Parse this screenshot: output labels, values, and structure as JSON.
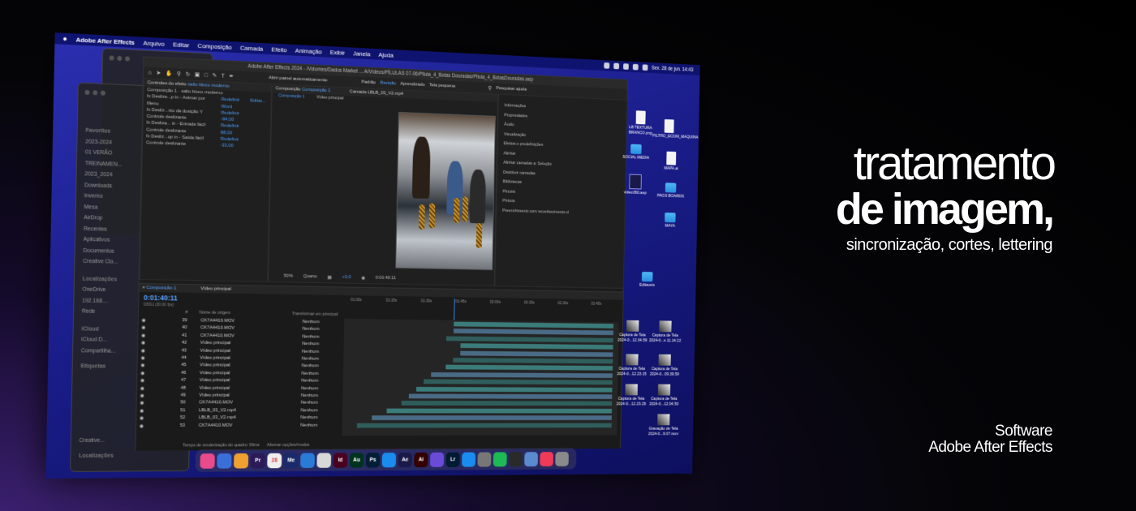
{
  "menubar": {
    "apple": "",
    "app": "Adobe After Effects",
    "items": [
      "Arquivo",
      "Editar",
      "Composição",
      "Camada",
      "Efeito",
      "Animação",
      "Exibir",
      "Janela",
      "Ajuda"
    ],
    "clock": "Sex. 28 de jun.  14:43"
  },
  "finder": {
    "favorites_header": "Favoritos",
    "items": [
      "2023-2024",
      "01 VERÃO",
      "TREINAMEN...",
      "2023_2024",
      "Downloads",
      "Inverno",
      "Mesa",
      "AirDrop",
      "Recentes",
      "Aplicativos",
      "Documentos",
      "Creative Clo..."
    ],
    "locations_header": "Localizações",
    "locations": [
      "OneDrive",
      "192.168....",
      "Rede"
    ],
    "icloud_header": "iCloud",
    "icloud": [
      "iCloud D...",
      "Compartilha..."
    ],
    "tags_header": "Etiquetas",
    "creative": "Creative...",
    "loc2": "Localizações"
  },
  "ae": {
    "title": "Adobe After Effects 2024 - /Volumes/Dados Market ... A/Vídeos/PÍLULAS 07-06/Pilula_4_Botas Douradas/Pilula_4_BotasDouradas.aep",
    "auto_open": "Abrir painel automaticamente",
    "workspace": [
      "Padrão",
      "Revisão",
      "Aprendizado",
      "Tela pequena"
    ],
    "effects_panel": "Controles do efeito",
    "effects_layer": "salto bloco moderno",
    "comp_tab": "Composição",
    "comp_name": "Composição 1",
    "effects_rows": [
      {
        "label": "Composição 1 · salto bloco moderno",
        "v": ""
      },
      {
        "label": "fx  Deslize...p in - Animar por",
        "v": "Redefinir",
        "e": "Editar..."
      },
      {
        "label": "    Menu",
        "v": "Word"
      },
      {
        "label": "fx  Desliz...nto da dosição Y",
        "v": "Redefinir"
      },
      {
        "label": "    Controle deslizante",
        "v": "-94,00"
      },
      {
        "label": "fx  Desliza... in - Entrada fácil",
        "v": "Redefinir"
      },
      {
        "label": "    Controle deslizante",
        "v": "88,00"
      },
      {
        "label": "fx  Desliz...op in - Saída fácil",
        "v": "Redefinir"
      },
      {
        "label": "    Controle deslizante",
        "v": "-33,00"
      }
    ],
    "footage_tab": "Camada LBLB_03_V2.mp4",
    "comp_subtabs": [
      "Composição 1",
      "Vídeo principal"
    ],
    "viewer_zoom": "50%",
    "viewer_res": "Quarto",
    "viewer_exposure": "+0,0",
    "viewer_time": "0:01:40:11",
    "right_panel": {
      "search": "Pesquisar ajuda",
      "items": [
        "Informações",
        "Propriedades",
        "Áudio",
        "Visualização",
        "Efeitos e predefinições",
        "Alinhar",
        "Alinhar camadas a:  Seleção",
        "Distribuir camadas",
        "Bibliotecas",
        "Pincéis",
        "Pintura",
        "Preenchimento com reconhecimento d"
      ]
    },
    "timeline": {
      "tab": "Composição 1",
      "tab2": "Vídeo principal",
      "time": "0:01:40:11",
      "fps": "03011 (30,00 fps)",
      "cols": [
        "#",
        "Nome de origem",
        "Transformar em principal"
      ],
      "ruler": [
        "01:00s",
        "01:15s",
        "01:30s",
        "01:45s",
        "02:00s",
        "02:15s",
        "02:30s",
        "02:45s"
      ],
      "layers": [
        {
          "n": "39",
          "name": "CK7A4410.MOV",
          "p": "Nenhum"
        },
        {
          "n": "40",
          "name": "CK7A4410.MOV",
          "p": "Nenhum"
        },
        {
          "n": "41",
          "name": "CK7A4410.MOV",
          "p": "Nenhum"
        },
        {
          "n": "42",
          "name": "Vídeo principal",
          "p": "Nenhum"
        },
        {
          "n": "43",
          "name": "Vídeo principal",
          "p": "Nenhum"
        },
        {
          "n": "44",
          "name": "Vídeo principal",
          "p": "Nenhum"
        },
        {
          "n": "45",
          "name": "Vídeo principal",
          "p": "Nenhum"
        },
        {
          "n": "46",
          "name": "Vídeo principal",
          "p": "Nenhum"
        },
        {
          "n": "47",
          "name": "Vídeo principal",
          "p": "Nenhum"
        },
        {
          "n": "48",
          "name": "Vídeo principal",
          "p": "Nenhum"
        },
        {
          "n": "49",
          "name": "Vídeo principal",
          "p": "Nenhum"
        },
        {
          "n": "50",
          "name": "CK7A4410.MOV",
          "p": "Nenhum"
        },
        {
          "n": "51",
          "name": "LBLB_03_V2.mp4",
          "p": "Nenhum"
        },
        {
          "n": "52",
          "name": "LBLB_03_V2.mp4",
          "p": "Nenhum"
        },
        {
          "n": "53",
          "name": "CK7A4410.MOV",
          "p": "Nenhum"
        }
      ],
      "render_time": "Tempo de renderização do quadro: 56ms",
      "toggle": "Alternar opções/modos"
    }
  },
  "desktop": {
    "icons": [
      {
        "label": "LB TEXTURA BRANCO.png",
        "kind": "doc"
      },
      {
        "label": "FILTRO_ECOM_MAQUINA.xmp",
        "kind": "doc"
      },
      {
        "label": "SOCIAL MEDIA",
        "kind": "fold"
      },
      {
        "label": "MAPA.ai",
        "kind": "doc"
      },
      {
        "label": "video360.aep",
        "kind": "ae"
      },
      {
        "label": "PAGS BOARDS",
        "kind": "fold"
      },
      {
        "label": "MAYA",
        "kind": "fold"
      },
      {
        "label": "Editaveis",
        "kind": "fold"
      },
      {
        "label": "Captura de Tela 2024-0...12.04.59",
        "kind": "shot"
      },
      {
        "label": "Captura de Tela 2024-0...s 11.14.22",
        "kind": "shot"
      },
      {
        "label": "Captura de Tela 2024-0...12.23.15",
        "kind": "shot"
      },
      {
        "label": "Captura de Tela 2024-0...09.39.59",
        "kind": "shot"
      },
      {
        "label": "Captura de Tela 2024-0...12.23.29",
        "kind": "shot"
      },
      {
        "label": "Captura de Tela 2024-0...12.04.50",
        "kind": "shot"
      },
      {
        "label": "Gravação de Tela 2024-0...9.07.mov",
        "kind": "shot"
      }
    ]
  },
  "dock": {
    "apps": [
      {
        "label": "",
        "c": "#e94a8a"
      },
      {
        "label": "",
        "c": "#3a6fd8"
      },
      {
        "label": "",
        "c": "#f0a030"
      },
      {
        "label": "Pr",
        "c": "#2b1a57"
      },
      {
        "label": "28",
        "c": "#eeeeee"
      },
      {
        "label": "Me",
        "c": "#1a2a6a"
      },
      {
        "label": "",
        "c": "#2a7bd8"
      },
      {
        "label": "",
        "c": "#d8d8d8"
      },
      {
        "label": "Id",
        "c": "#49021f"
      },
      {
        "label": "Au",
        "c": "#00331f"
      },
      {
        "label": "Ps",
        "c": "#001e36"
      },
      {
        "label": "",
        "c": "#1a8cf0"
      },
      {
        "label": "Ae",
        "c": "#1a1a4a"
      },
      {
        "label": "Ai",
        "c": "#330000"
      },
      {
        "label": "",
        "c": "#6a4bd8"
      },
      {
        "label": "Lr",
        "c": "#001a33"
      },
      {
        "label": "",
        "c": "#1a8cf0"
      },
      {
        "label": "",
        "c": "#777777"
      },
      {
        "label": "",
        "c": "#1db954"
      },
      {
        "label": "",
        "c": "#2a2a2a"
      },
      {
        "label": "",
        "c": "#5a8ad0"
      },
      {
        "label": "",
        "c": "#f03a5a"
      },
      {
        "label": "",
        "c": "#8a8a8a"
      }
    ]
  },
  "headline": {
    "line1": "tratamento",
    "line2": "de imagem,",
    "line3": "sincronização, cortes, lettering",
    "footer1": "Software",
    "footer2": "Adobe After Effects"
  }
}
